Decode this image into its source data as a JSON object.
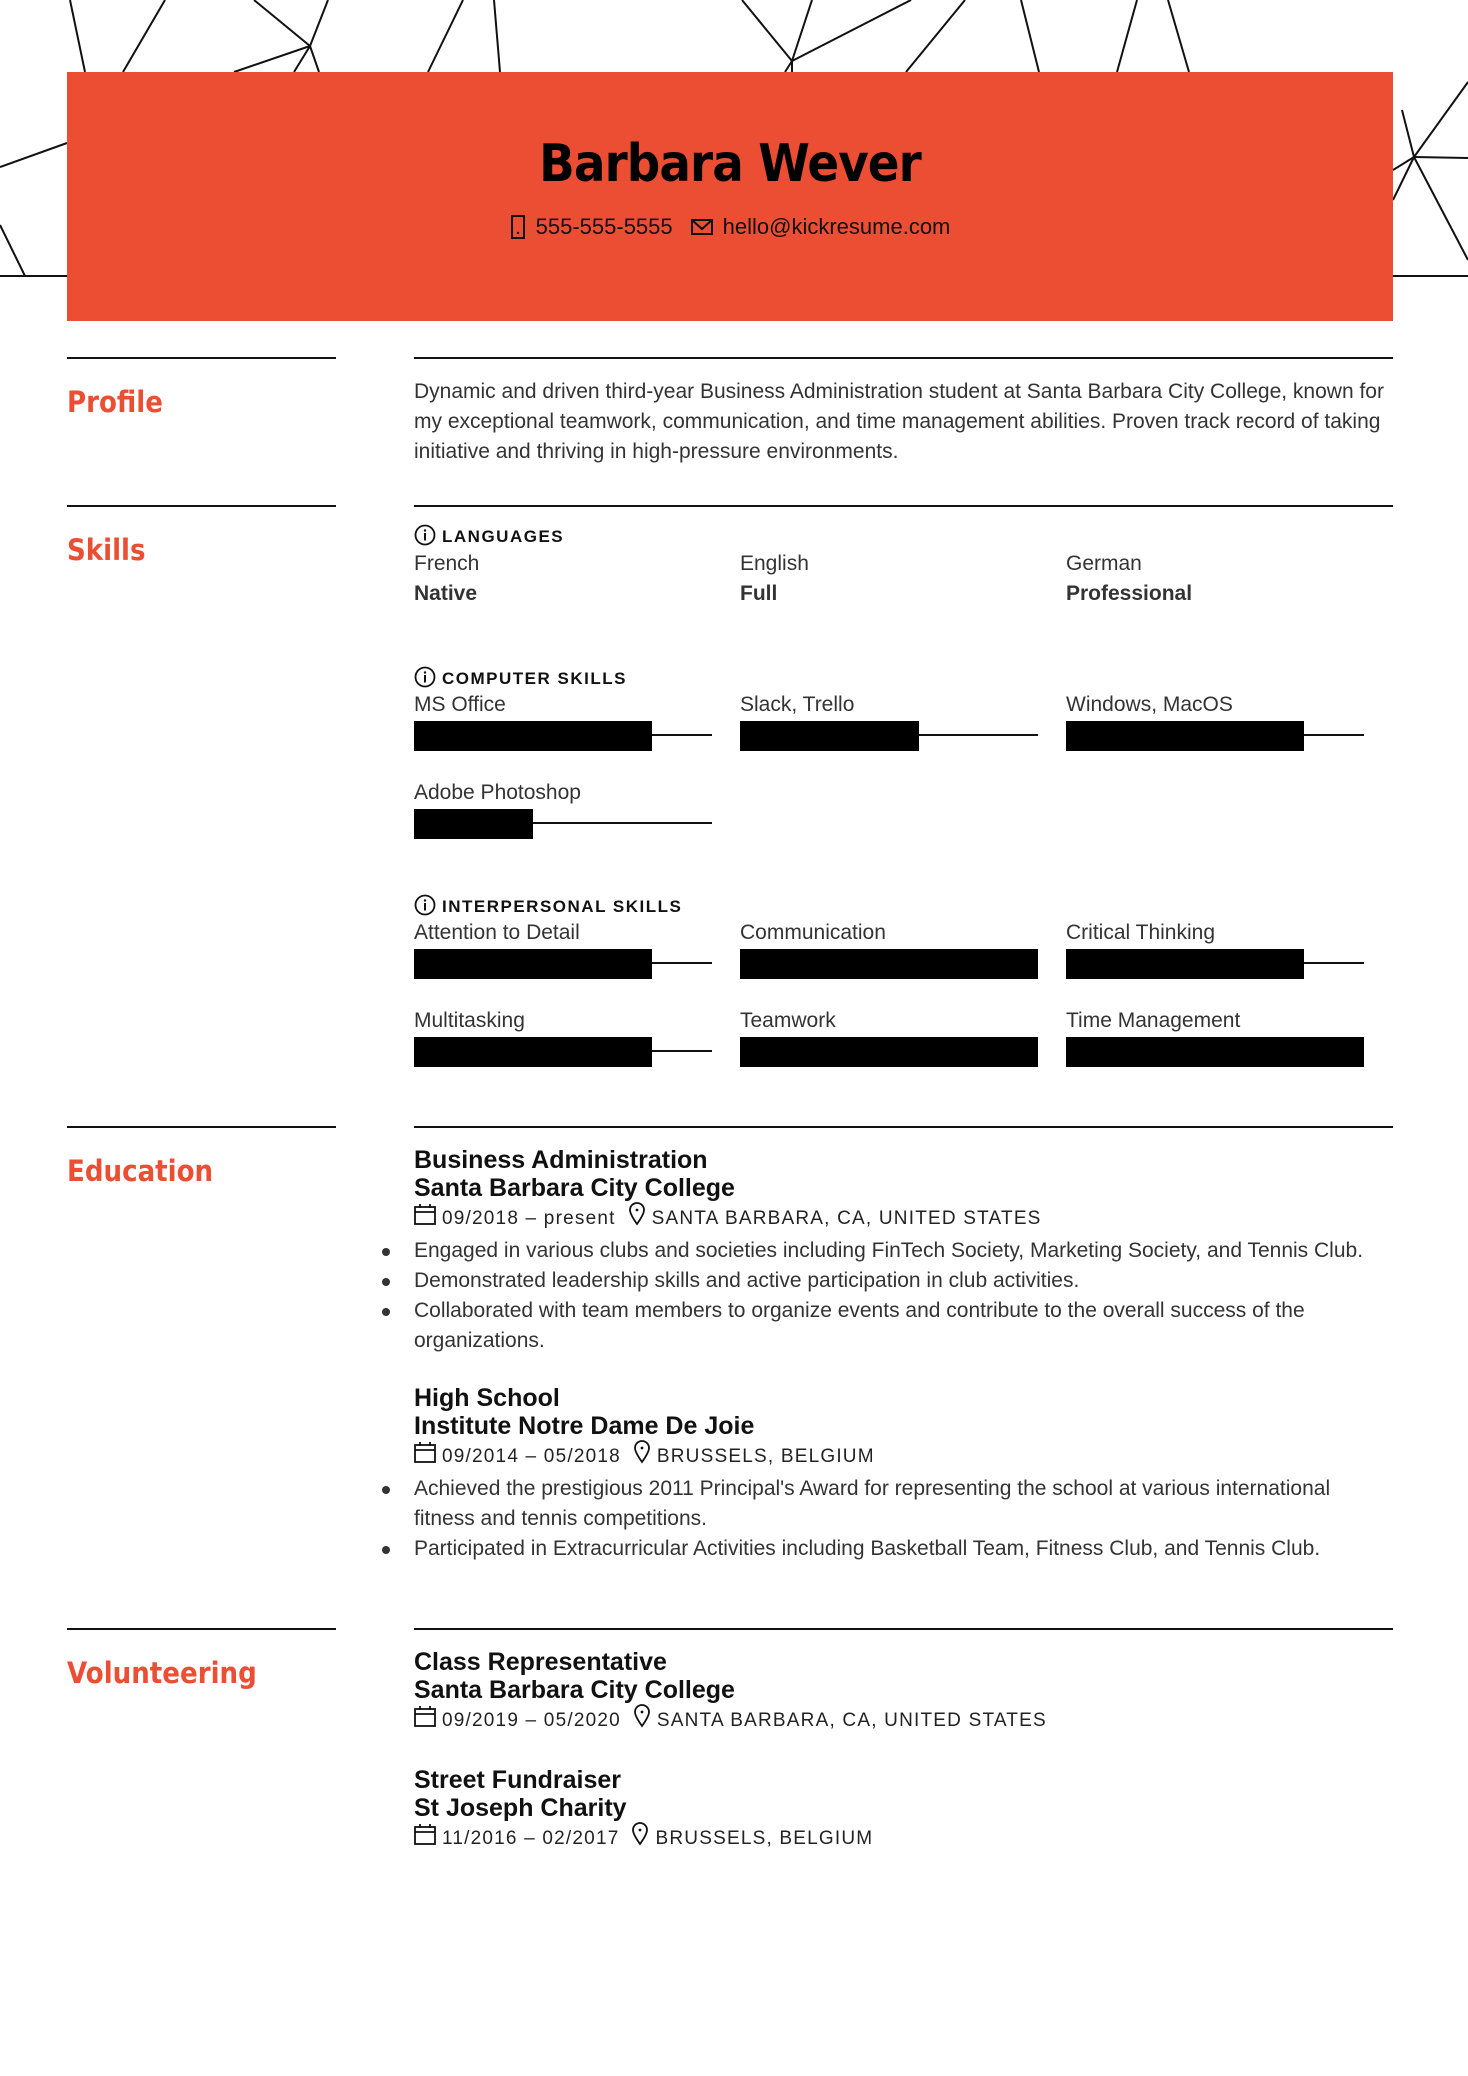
{
  "header": {
    "name": "Barbara Wever",
    "phone": "555-555-5555",
    "email": "hello@kickresume.com",
    "phone_icon": "phone-icon",
    "email_icon": "envelope-icon",
    "accent_color": "#ec4e33"
  },
  "profile": {
    "title": "Profile",
    "text": "Dynamic and driven third-year Business Administration student at Santa Barbara City College, known for my exceptional teamwork, communication, and time management abilities. Proven track record of taking initiative and thriving in high-pressure environments."
  },
  "skills": {
    "title": "Skills",
    "languages": {
      "heading": "LANGUAGES",
      "items": [
        {
          "name": "French",
          "level": "Native"
        },
        {
          "name": "English",
          "level": "Full"
        },
        {
          "name": "German",
          "level": "Professional"
        }
      ]
    },
    "computer": {
      "heading": "COMPUTER SKILLS",
      "items": [
        {
          "name": "MS Office",
          "level": 0.8
        },
        {
          "name": "Slack, Trello",
          "level": 0.6
        },
        {
          "name": "Windows, MacOS",
          "level": 0.8
        },
        {
          "name": "Adobe Photoshop",
          "level": 0.4
        }
      ]
    },
    "interpersonal": {
      "heading": "INTERPERSONAL SKILLS",
      "items": [
        {
          "name": "Attention to Detail",
          "level": 0.8
        },
        {
          "name": "Communication",
          "level": 1.0
        },
        {
          "name": "Critical Thinking",
          "level": 0.8
        },
        {
          "name": "Multitasking",
          "level": 0.8
        },
        {
          "name": "Teamwork",
          "level": 1.0
        },
        {
          "name": "Time Management",
          "level": 1.0
        }
      ]
    }
  },
  "education": {
    "title": "Education",
    "entries": [
      {
        "degree": "Business Administration",
        "school": "Santa Barbara City College",
        "dates": "09/2018 – present",
        "location": "SANTA BARBARA, CA, UNITED STATES",
        "bullets": [
          "Engaged in various clubs and societies including FinTech Society, Marketing Society, and Tennis Club.",
          "Demonstrated leadership skills and active participation in club activities.",
          "Collaborated with team members to organize events and contribute to the overall success of the organizations."
        ]
      },
      {
        "degree": "High School",
        "school": "Institute Notre Dame De Joie",
        "dates": "09/2014 – 05/2018",
        "location": "BRUSSELS, BELGIUM",
        "bullets": [
          "Achieved the prestigious 2011 Principal's Award for representing the school at various international fitness and tennis competitions.",
          "Participated in Extracurricular Activities including Basketball Team, Fitness Club, and Tennis Club."
        ]
      }
    ]
  },
  "volunteering": {
    "title": "Volunteering",
    "entries": [
      {
        "role": "Class Representative",
        "org": "Santa Barbara City College",
        "dates": "09/2019 – 05/2020",
        "location": "SANTA BARBARA, CA, UNITED STATES"
      },
      {
        "role": "Street Fundraiser",
        "org": "St Joseph Charity",
        "dates": "11/2016 – 02/2017",
        "location": "BRUSSELS, BELGIUM"
      }
    ]
  }
}
